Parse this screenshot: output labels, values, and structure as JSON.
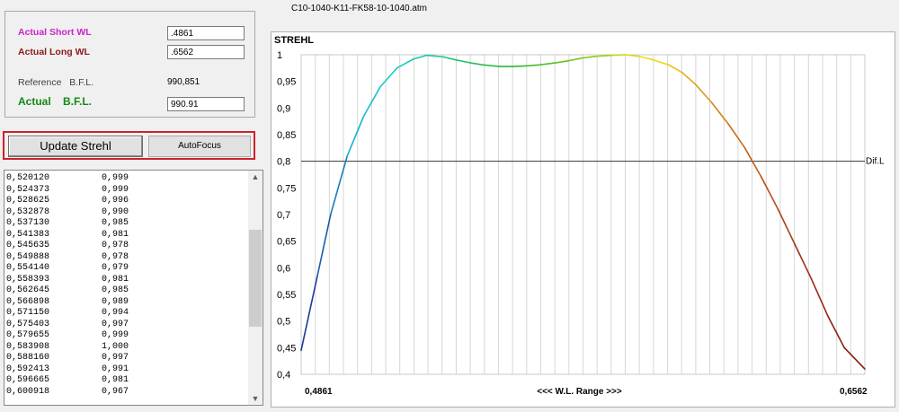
{
  "window": {
    "title": "C10-1040-K11-FK58-10-1040.atm"
  },
  "params": {
    "short_wl_label": "Actual Short WL",
    "short_wl_value": ".4861",
    "long_wl_label": "Actual Long WL",
    "long_wl_value": ".6562",
    "ref_bfl_label": "Reference   B.F.L.",
    "ref_bfl_value": "990,851",
    "actual_bfl_label": "Actual    B.F.L.",
    "actual_bfl_value": "990.91",
    "colors": {
      "short": "#cc22cc",
      "long": "#8b1a1a",
      "actual": "#138a13"
    }
  },
  "buttons": {
    "update": "Update Strehl",
    "autofocus": "AutoFocus"
  },
  "results": [
    [
      "0,520120",
      "0,999"
    ],
    [
      "0,524373",
      "0,999"
    ],
    [
      "0,528625",
      "0,996"
    ],
    [
      "0,532878",
      "0,990"
    ],
    [
      "0,537130",
      "0,985"
    ],
    [
      "0,541383",
      "0,981"
    ],
    [
      "0,545635",
      "0,978"
    ],
    [
      "0,549888",
      "0,978"
    ],
    [
      "0,554140",
      "0,979"
    ],
    [
      "0,558393",
      "0,981"
    ],
    [
      "0,562645",
      "0,985"
    ],
    [
      "0,566898",
      "0,989"
    ],
    [
      "0,571150",
      "0,994"
    ],
    [
      "0,575403",
      "0,997"
    ],
    [
      "0,579655",
      "0,999"
    ],
    [
      "0,583908",
      "1,000"
    ],
    [
      "0,588160",
      "0,997"
    ],
    [
      "0,592413",
      "0,991"
    ],
    [
      "0,596665",
      "0,981"
    ],
    [
      "0,600918",
      "0,967"
    ]
  ],
  "scrollbar": {
    "up_icon": "▲",
    "down_icon": "▼"
  },
  "chart_data": {
    "type": "line",
    "title": "STREHL",
    "xlabel": "<<<  W.L. Range  >>>",
    "x_min_label": "0,4861",
    "x_max_label": "0,6562",
    "xlim": [
      0.4861,
      0.6562
    ],
    "ylim": [
      0.4,
      1.0
    ],
    "yticks": [
      "1",
      "0,95",
      "0,9",
      "0,85",
      "0,8",
      "0,75",
      "0,7",
      "0,65",
      "0,6",
      "0,55",
      "0,5",
      "0,45",
      "0,4"
    ],
    "reference_line": {
      "y": 0.8,
      "label": "Dif.L"
    },
    "grid": "vertical",
    "series": [
      {
        "x": [
          0.4861,
          0.491,
          0.495,
          0.5,
          0.505,
          0.51,
          0.515,
          0.52,
          0.524,
          0.529,
          0.533,
          0.537,
          0.541,
          0.546,
          0.55,
          0.554,
          0.558,
          0.563,
          0.567,
          0.571,
          0.575,
          0.58,
          0.584,
          0.588,
          0.592,
          0.597,
          0.601,
          0.605,
          0.61,
          0.615,
          0.62,
          0.625,
          0.63,
          0.635,
          0.64,
          0.645,
          0.65,
          0.6562
        ],
        "y": [
          0.445,
          0.585,
          0.7,
          0.81,
          0.885,
          0.94,
          0.975,
          0.992,
          0.999,
          0.996,
          0.99,
          0.985,
          0.981,
          0.978,
          0.978,
          0.979,
          0.981,
          0.985,
          0.989,
          0.994,
          0.997,
          0.999,
          1.0,
          0.997,
          0.991,
          0.981,
          0.967,
          0.945,
          0.91,
          0.87,
          0.825,
          0.77,
          0.71,
          0.645,
          0.58,
          0.51,
          0.45,
          0.41
        ]
      }
    ]
  }
}
